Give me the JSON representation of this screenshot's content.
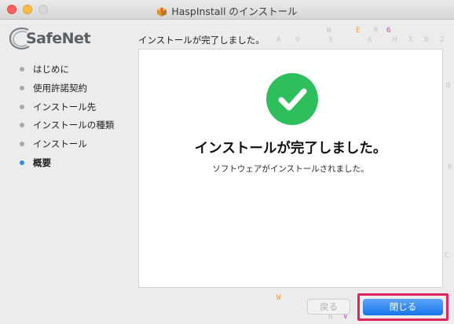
{
  "window": {
    "title": "HaspInstall のインストール",
    "title_icon": "package-icon"
  },
  "brand": {
    "logo_text": "SafeNet"
  },
  "sidebar": {
    "steps": [
      {
        "label": "はじめに",
        "active": false
      },
      {
        "label": "使用許諾契約",
        "active": false
      },
      {
        "label": "インストール先",
        "active": false
      },
      {
        "label": "インストールの種類",
        "active": false
      },
      {
        "label": "インストール",
        "active": false
      },
      {
        "label": "概要",
        "active": true
      }
    ]
  },
  "main": {
    "header": "インストールが完了しました。",
    "success_icon": "checkmark-circle-icon",
    "title": "インストールが完了しました。",
    "message": "ソフトウェアがインストールされました。"
  },
  "buttons": {
    "back_label": "戻る",
    "close_label": "閉じる"
  },
  "colors": {
    "accent": "#1674e9",
    "success": "#2ebf5c",
    "highlight": "#e0245e"
  }
}
